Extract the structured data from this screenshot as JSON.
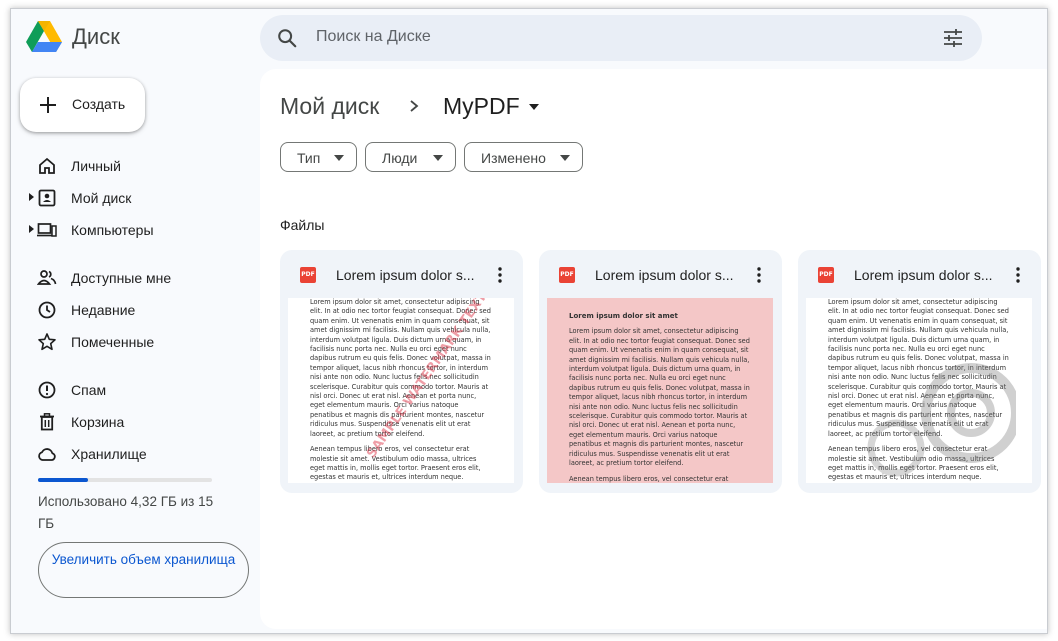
{
  "app": {
    "name": "Диск"
  },
  "search": {
    "placeholder": "Поиск на Диске"
  },
  "sidebar": {
    "create_label": "Создать",
    "items": [
      {
        "label": "Личный",
        "icon": "home-icon"
      },
      {
        "label": "Мой диск",
        "icon": "my-drive-icon"
      },
      {
        "label": "Компьютеры",
        "icon": "computers-icon"
      },
      {
        "label": "Доступные мне",
        "icon": "shared-icon"
      },
      {
        "label": "Недавние",
        "icon": "clock-icon"
      },
      {
        "label": "Помеченные",
        "icon": "star-icon"
      },
      {
        "label": "Спам",
        "icon": "spam-icon"
      },
      {
        "label": "Корзина",
        "icon": "trash-icon"
      },
      {
        "label": "Хранилище",
        "icon": "cloud-icon"
      }
    ],
    "storage": {
      "used_fraction": 0.288,
      "text": "Использовано 4,32 ГБ из 15 ГБ"
    },
    "upgrade_label": "Увеличить объем хранилища"
  },
  "main": {
    "breadcrumb": {
      "root": "Мой диск",
      "current": "MyPDF"
    },
    "filters": [
      "Тип",
      "Люди",
      "Изменено"
    ],
    "section_title": "Файлы",
    "files": [
      {
        "name": "Lorem ipsum dolor s..."
      },
      {
        "name": "Lorem ipsum dolor s..."
      },
      {
        "name": "Lorem ipsum dolor s..."
      }
    ],
    "preview": {
      "title": "Lorem ipsum dolor sit amet",
      "p1": "Lorem ipsum dolor sit amet, consectetur adipiscing elit. In at odio nec tortor feugiat consequat. Donec sed quam enim. Ut venenatis enim in quam consequat, sit amet dignissim mi facilisis. Nullam quis vehicula nulla, interdum volutpat ligula. Duis dictum urna quam, in facilisis nunc porta nec. Nulla eu orci eget nunc dapibus rutrum eu quis felis. Donec volutpat, massa in tempor aliquet, lacus nibh rhoncus tortor, in interdum nisi ante non odio. Nunc luctus felis nec sollicitudin scelerisque. Curabitur quis commodo tortor. Mauris at nisl orci. Donec ut erat nisl. Aenean et porta nunc, eget elementum mauris. Orci varius natoque penatibus et magnis dis parturient montes, nascetur ridiculus mus. Suspendisse venenatis elit ut erat laoreet, ac pretium tortor eleifend.",
      "p2": "Aenean tempus libero eros, vel consectetur erat molestie sit amet. Vestibulum odio massa, ultrices eget mattis in, mollis eget tortor. Praesent eros elit, egestas et mauris et, ultrices interdum neque. Pellentesque habitant morbi tristique senectus et netus et malesuada fames ac turpis egestas. Nullam accumsan ante a eleifend tincidunt. Maecenas ut nulla sodales, rhoncus nisi non, interdum lectus. Quisque molestie ipsum non ornare nibh congue. Curabitur faucibus sed enim efficitur. Nullam ullamcorper, massa et"
    }
  }
}
